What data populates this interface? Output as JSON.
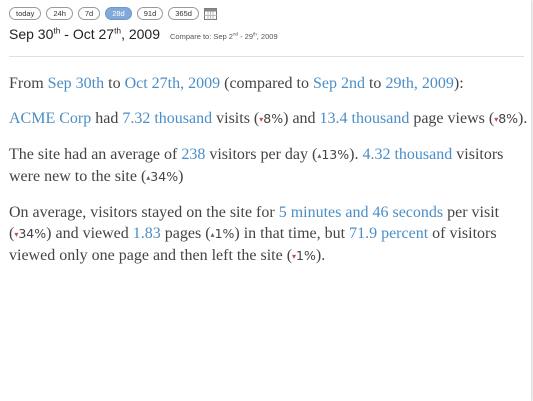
{
  "ranges": [
    "today",
    "24h",
    "7d",
    "28d",
    "91d",
    "365d"
  ],
  "active_range": "28d",
  "header": {
    "start_month": "Sep 30",
    "start_sup": "th",
    "sep": " - ",
    "end_month": "Oct 27",
    "end_sup": "th",
    "year": ", 2009",
    "compare_prefix": "Compare to: Sep 2",
    "compare_sup1": "nd",
    "compare_mid": " - 29",
    "compare_sup2": "th",
    "compare_year": ", 2009"
  },
  "summary": {
    "p1_from": "From ",
    "p1_start": "Sep 30th",
    "p1_to": " to ",
    "p1_end": "Oct 27th, 2009",
    "p1_cmp": " (compared to ",
    "p1_cmp_start": "Sep 2nd",
    "p1_cmp_to": " to ",
    "p1_cmp_end": "29th, 2009",
    "p1_close": "):",
    "company": "ACME Corp",
    "had": " had ",
    "visits": "7.32 thousand",
    "visits_txt": " visits (",
    "visits_delta": "8%",
    "and": ") and ",
    "pageviews": "13.4 thousand",
    "pageviews_txt": " page views (",
    "pageviews_delta": "8%",
    "p2_close": ").",
    "p3_a": "The site had an average of ",
    "avg_visitors": "238",
    "p3_b": " visitors per day (",
    "avg_delta": "13%",
    "p3_c": "). ",
    "new_visitors": "4.32 thousand",
    "p3_d": " visitors were new to the site (",
    "new_delta": "34%",
    "p3_e": ")",
    "p4_a": "On average, visitors stayed on the site for ",
    "duration": "5 minutes and 46 seconds",
    "p4_b": " per visit (",
    "duration_delta": "34%",
    "p4_c": ") and viewed ",
    "pages": "1.83",
    "p4_d": " pages (",
    "pages_delta": "1%",
    "p4_e": ") in that time, but ",
    "bounce": "71.9 percent",
    "p4_f": " of visitors viewed only one page and then left the site (",
    "bounce_delta": "1%",
    "p4_g": ")."
  },
  "colors": {
    "link": "#4b8ec6",
    "active_range": "#82aad8",
    "down": "#c94a4a"
  },
  "icons": {
    "calendar": "calendar-icon"
  }
}
